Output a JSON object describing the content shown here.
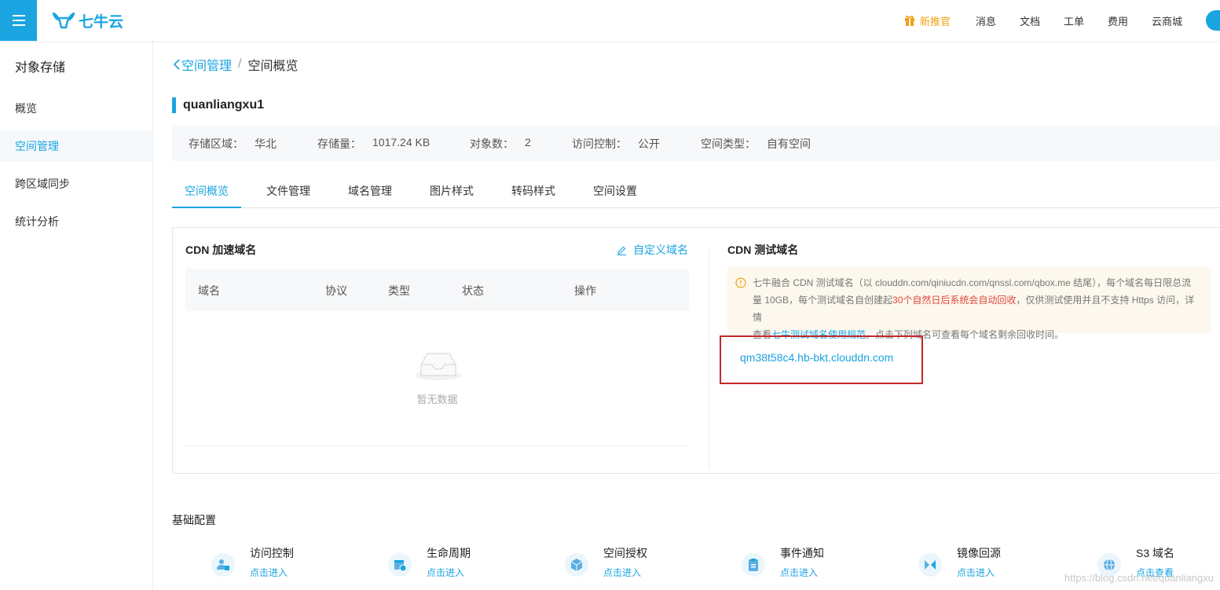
{
  "topbar": {
    "logo_text": "七牛云",
    "nav": [
      "消息",
      "文档",
      "工单",
      "费用",
      "云商城"
    ],
    "new_label": "新推官"
  },
  "sidebar": {
    "title": "对象存储",
    "items": [
      {
        "label": "概览"
      },
      {
        "label": "空间管理"
      },
      {
        "label": "跨区域同步"
      },
      {
        "label": "统计分析"
      }
    ]
  },
  "breadcrumb": {
    "back": "空间管理",
    "sep": "/",
    "current": "空间概览"
  },
  "bucket": {
    "name": "quanliangxu1"
  },
  "info": [
    {
      "k": "存储区域：",
      "v": "华北"
    },
    {
      "k": "存储量：",
      "v": "1017.24 KB"
    },
    {
      "k": "对象数：",
      "v": "2"
    },
    {
      "k": "访问控制：",
      "v": "公开"
    },
    {
      "k": "空间类型：",
      "v": "自有空间"
    }
  ],
  "tabs": [
    "空间概览",
    "文件管理",
    "域名管理",
    "图片样式",
    "转码样式",
    "空间设置"
  ],
  "cdn": {
    "title": "CDN 加速域名",
    "custom_link": "自定义域名",
    "columns": [
      "域名",
      "协议",
      "类型",
      "状态",
      "操作"
    ],
    "empty_text": "暂无数据"
  },
  "test": {
    "title": "CDN 测试域名",
    "notice_1": "七牛融合 CDN 测试域名（以 clouddn.com/qiniucdn.com/qnssl.com/qbox.me 结尾），每个域名每日限总流",
    "notice_2a": "量 10GB，每个测试域名自创建起",
    "notice_2red": "30个自然日后系统会自动回收",
    "notice_2b": "，仅供测试使用并且不支持 Https 访问，详情",
    "notice_3a": "查看",
    "notice_3link": "七牛测试域名使用规范",
    "notice_3b": "。点击下列域名可查看每个域名剩余回收时间。",
    "domain": "qm38t58c4.hb-bkt.clouddn.com"
  },
  "basic": {
    "title": "基础配置",
    "features": [
      {
        "name": "访问控制",
        "link": "点击进入",
        "icon": "users-icon"
      },
      {
        "name": "生命周期",
        "link": "点击进入",
        "icon": "calendar-icon"
      },
      {
        "name": "空间授权",
        "link": "点击进入",
        "icon": "box-icon"
      },
      {
        "name": "事件通知",
        "link": "点击进入",
        "icon": "clipboard-icon"
      },
      {
        "name": "镜像回源",
        "link": "点击进入",
        "icon": "mirror-icon"
      },
      {
        "name": "S3 域名",
        "link": "点击查看",
        "icon": "globe-icon"
      }
    ]
  },
  "watermark": "https://blog.csdn.net/quanliangxu",
  "colors": {
    "accent": "#1aa4e0",
    "highlight_border": "#c4282a",
    "warn": "#f0a010"
  }
}
